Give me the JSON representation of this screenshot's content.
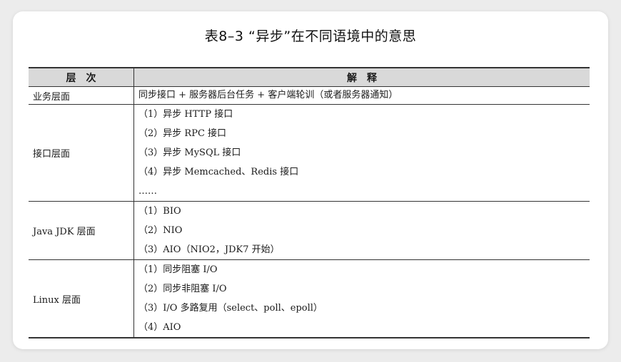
{
  "title": "表8–3 “异步”在不同语境中的意思",
  "table": {
    "headers": [
      "层　次",
      "解　释"
    ],
    "rows": [
      {
        "layer": "业务层面",
        "items": [
          "同步接口 + 服务器后台任务 + 客户端轮训（或者服务器通知）"
        ]
      },
      {
        "layer": "接口层面",
        "items": [
          "（1）异步 HTTP 接口",
          "（2）异步 RPC 接口",
          "（3）异步 MySQL 接口",
          "（4）异步 Memcached、Redis 接口",
          "……"
        ]
      },
      {
        "layer": "Java JDK 层面",
        "items": [
          "（1）BIO",
          "（2）NIO",
          "（3）AIO（NIO2，JDK7 开始）"
        ]
      },
      {
        "layer": "Linux 层面",
        "items": [
          "（1）同步阻塞 I/O",
          "（2）同步非阻塞 I/O",
          "（3）I/O 多路复用（select、poll、epoll）",
          "（4）AIO"
        ]
      }
    ]
  }
}
